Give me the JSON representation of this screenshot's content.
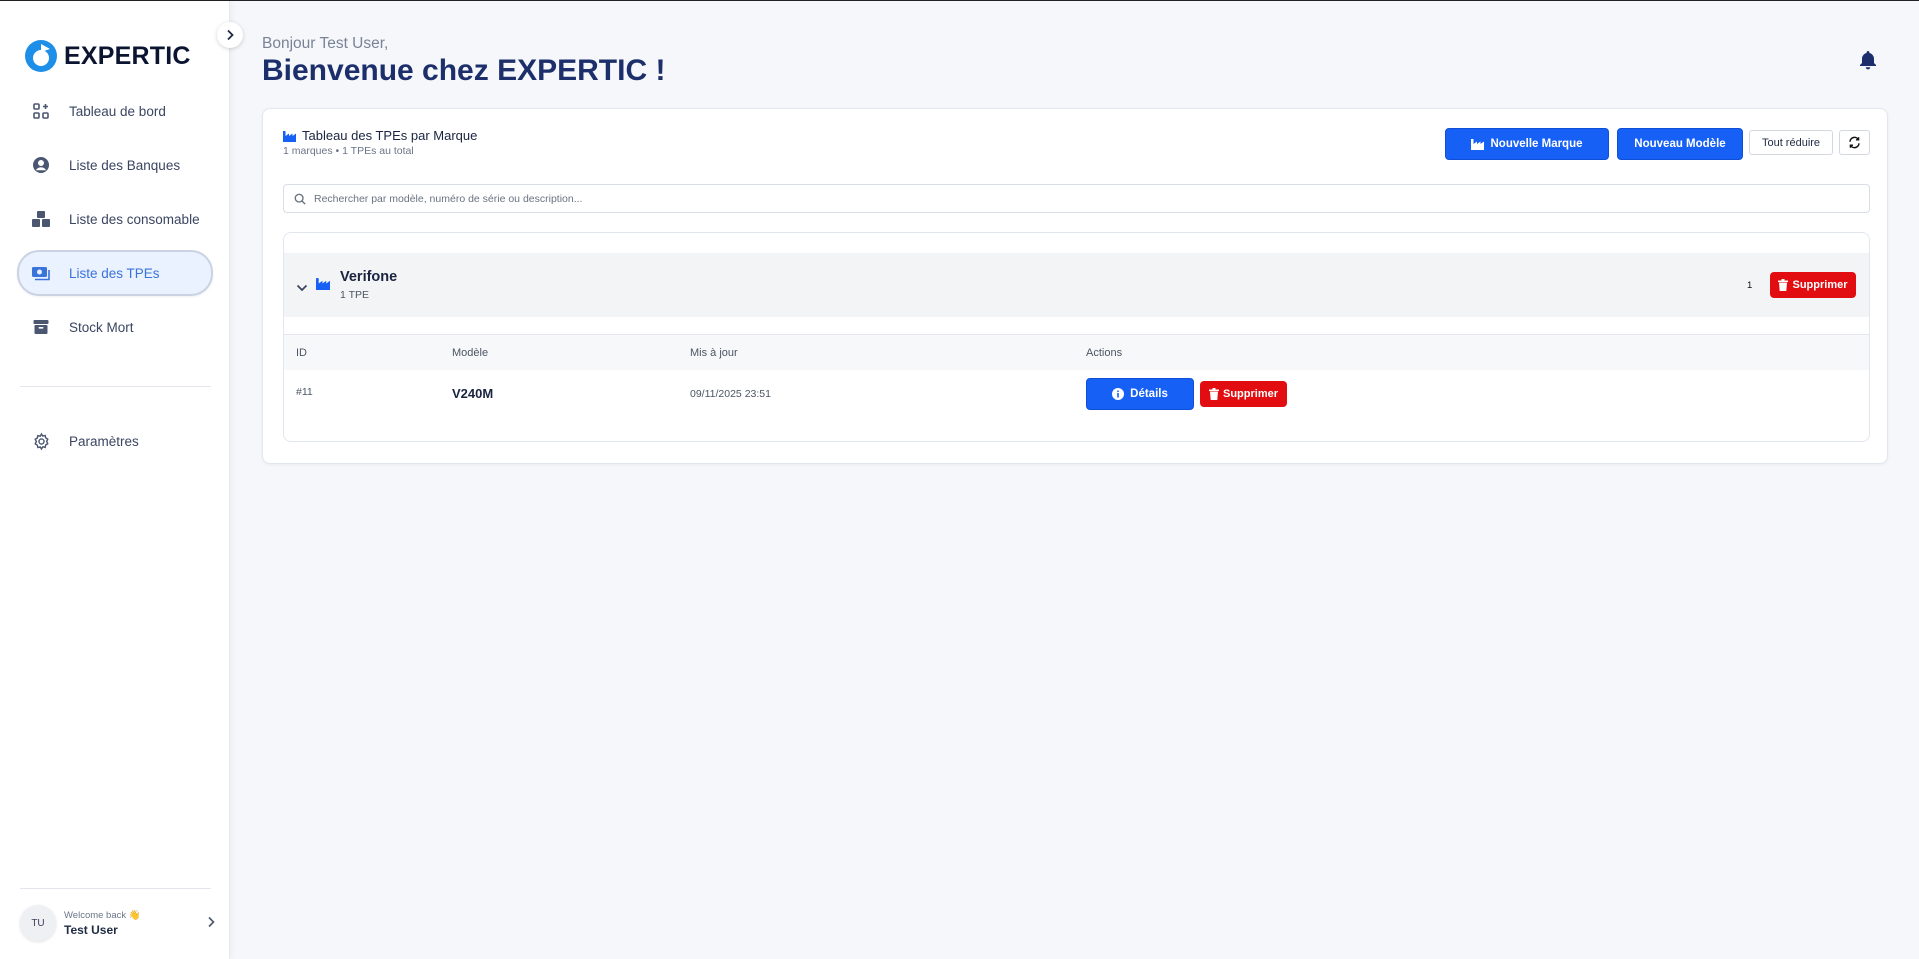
{
  "sidebar": {
    "logo_text": "EXPERTIC",
    "items": [
      {
        "label": "Tableau de bord",
        "icon": "dashboard-icon"
      },
      {
        "label": "Liste des Banques",
        "icon": "user-circle-icon"
      },
      {
        "label": "Liste des consomable",
        "icon": "boxes-icon"
      },
      {
        "label": "Liste des TPEs",
        "icon": "money-icon",
        "active": true
      },
      {
        "label": "Stock Mort",
        "icon": "archive-icon"
      }
    ],
    "settings_label": "Paramètres",
    "user": {
      "initials": "TU",
      "welcome": "Welcome back 👋",
      "name": "Test User"
    }
  },
  "header": {
    "greeting": "Bonjour Test User,",
    "title": "Bienvenue chez EXPERTIC !"
  },
  "card": {
    "title": "Tableau des TPEs par Marque",
    "subtitle": "1 marques • 1 TPEs au total",
    "buttons": {
      "new_brand": "Nouvelle Marque",
      "new_model": "Nouveau Modèle",
      "collapse_all": "Tout réduire"
    },
    "search_placeholder": "Rechercher par modèle, numéro de série ou description...",
    "brands": [
      {
        "name": "Verifone",
        "count_label": "1 TPE",
        "count": "1",
        "delete_label": "Supprimer",
        "columns": [
          "ID",
          "Modèle",
          "Mis à jour",
          "Actions"
        ],
        "rows": [
          {
            "id": "#11",
            "model": "V240M",
            "updated": "09/11/2025 23:51",
            "details_label": "Détails",
            "delete_label": "Supprimer"
          }
        ]
      }
    ]
  },
  "colors": {
    "primary": "#1660f5",
    "danger": "#e20d10",
    "title": "#1c2f6b",
    "active_nav_bg": "#eaf1ff"
  }
}
